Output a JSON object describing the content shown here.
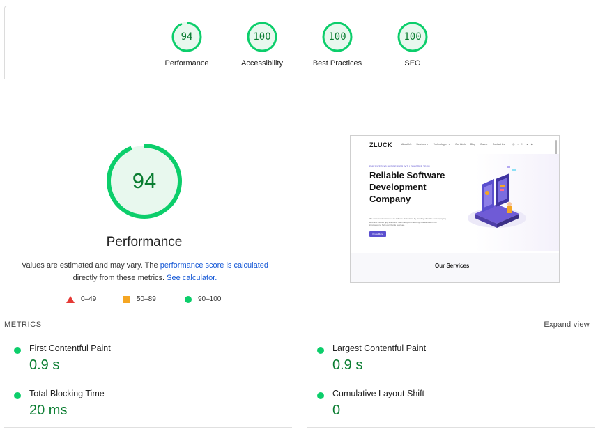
{
  "summary": [
    {
      "score": "94",
      "label": "Performance"
    },
    {
      "score": "100",
      "label": "Accessibility"
    },
    {
      "score": "100",
      "label": "Best Practices"
    },
    {
      "score": "100",
      "label": "SEO"
    }
  ],
  "performance": {
    "score": "94",
    "title": "Performance",
    "note_prefix": "Values are estimated and may vary. The ",
    "note_link1": "performance score is calculated",
    "note_middle": " directly from these metrics. ",
    "note_link2": "See calculator.",
    "legend": [
      {
        "shape": "triangle",
        "range": "0–49"
      },
      {
        "shape": "square",
        "range": "50–89"
      },
      {
        "shape": "circle",
        "range": "90–100"
      }
    ]
  },
  "screenshot": {
    "logo": "ZLUCK",
    "menu": [
      "About Us",
      "Services ⌄",
      "Technologies ⌄",
      "Our Work",
      "Blog",
      "Career",
      "Contact Us"
    ],
    "kicker": "EMPOWERING BUSINESSES WITH TAILORED TECH",
    "heading": "Reliable Software Development Company",
    "sub": "We empower businesses to achieve their vision by creating effective and engaging web and mobile app solutions. We champion creativity, collaboration and innovation to help our clients succeed.",
    "button": "Know More",
    "services_title": "Our Services"
  },
  "metrics": {
    "label": "METRICS",
    "expand": "Expand view",
    "items": [
      {
        "name": "First Contentful Paint",
        "value": "0.9 s"
      },
      {
        "name": "Largest Contentful Paint",
        "value": "0.9 s"
      },
      {
        "name": "Total Blocking Time",
        "value": "20 ms"
      },
      {
        "name": "Cumulative Layout Shift",
        "value": "0"
      }
    ]
  },
  "colors": {
    "pass": "#0cce6b",
    "pass_text": "#0a7d31",
    "pass_bg": "#e8f8ee",
    "link": "#1558d6"
  }
}
